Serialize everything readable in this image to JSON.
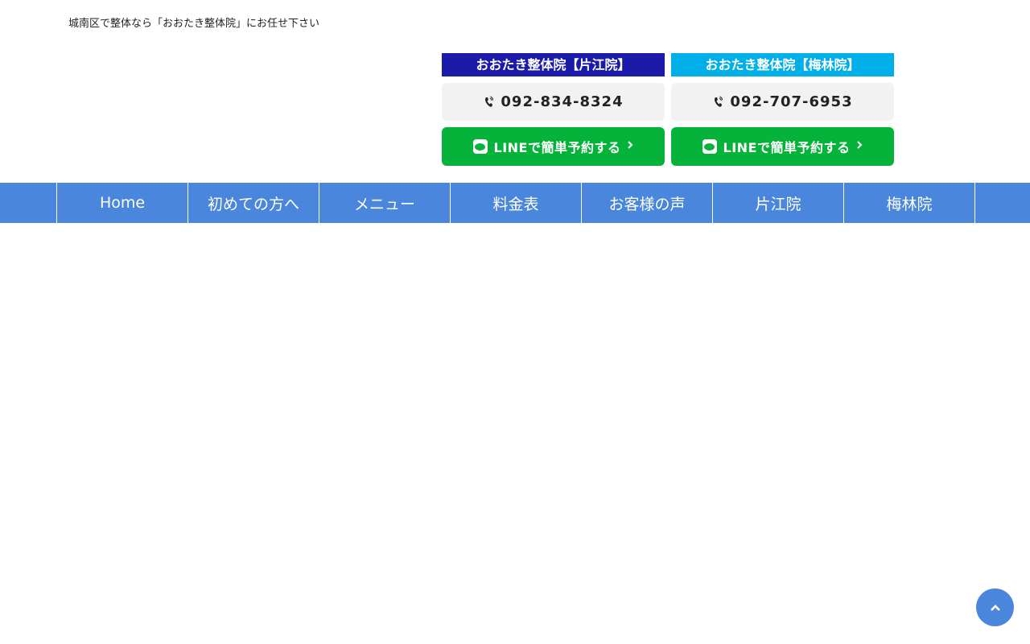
{
  "header": {
    "tagline": "城南区で整体なら「おおたき整体院」にお任せ下さい"
  },
  "clinics": [
    {
      "name": "おおたき整体院【片江院】",
      "phone": "092-834-8324",
      "line_label": "LINEで簡単予約する",
      "color": "#1c1aa8"
    },
    {
      "name": "おおたき整体院【梅林院】",
      "phone": "092-707-6953",
      "line_label": "LINEで簡単予約する",
      "color": "#00aee8"
    }
  ],
  "nav": {
    "items": [
      {
        "label": "Home"
      },
      {
        "label": "初めての方へ"
      },
      {
        "label": "メニュー"
      },
      {
        "label": "料金表"
      },
      {
        "label": "お客様の声"
      },
      {
        "label": "片江院"
      },
      {
        "label": "梅林院"
      }
    ],
    "color": "#4a86dc"
  },
  "icons": {
    "phone": "phone-icon",
    "line": "line-icon",
    "chevron": "chevron-right-icon",
    "scroll_top": "chevron-up-icon"
  },
  "colors": {
    "line_green": "#06b33a",
    "phone_bg": "#f2f2f2"
  }
}
